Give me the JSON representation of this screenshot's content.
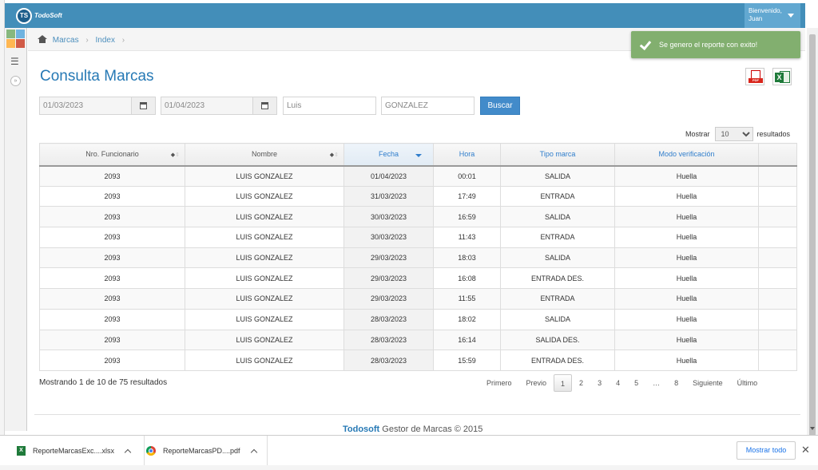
{
  "navbar": {
    "logo_initials": "TS",
    "logo_text": "TodoSoft",
    "welcome": "Bienvenido,",
    "user": "Juan"
  },
  "breadcrumb": [
    "Marcas",
    "Index"
  ],
  "toast": "Se genero el reporte con exito!",
  "page_title": "Consulta Marcas",
  "filters": {
    "date_from": "01/03/2023",
    "date_to": "01/04/2023",
    "first_name": "Luis",
    "last_name": "GONZALEZ",
    "search_button": "Buscar"
  },
  "export": {
    "pdf_label": "PDF",
    "xls_label": "X"
  },
  "page_size": {
    "before": "Mostrar",
    "value": "10",
    "after": "resultados"
  },
  "table": {
    "columns": [
      "Nro. Funcionario",
      "Nombre",
      "Fecha",
      "Hora",
      "Tipo marca",
      "Modo verificación",
      ""
    ],
    "rows": [
      [
        "2093",
        "LUIS GONZALEZ",
        "01/04/2023",
        "00:01",
        "SALIDA",
        "Huella",
        ""
      ],
      [
        "2093",
        "LUIS GONZALEZ",
        "31/03/2023",
        "17:49",
        "ENTRADA",
        "Huella",
        ""
      ],
      [
        "2093",
        "LUIS GONZALEZ",
        "30/03/2023",
        "16:59",
        "SALIDA",
        "Huella",
        ""
      ],
      [
        "2093",
        "LUIS GONZALEZ",
        "30/03/2023",
        "11:43",
        "ENTRADA",
        "Huella",
        ""
      ],
      [
        "2093",
        "LUIS GONZALEZ",
        "29/03/2023",
        "18:03",
        "SALIDA",
        "Huella",
        ""
      ],
      [
        "2093",
        "LUIS GONZALEZ",
        "29/03/2023",
        "16:08",
        "ENTRADA DES.",
        "Huella",
        ""
      ],
      [
        "2093",
        "LUIS GONZALEZ",
        "29/03/2023",
        "11:55",
        "ENTRADA",
        "Huella",
        ""
      ],
      [
        "2093",
        "LUIS GONZALEZ",
        "28/03/2023",
        "18:02",
        "SALIDA",
        "Huella",
        ""
      ],
      [
        "2093",
        "LUIS GONZALEZ",
        "28/03/2023",
        "16:14",
        "SALIDA DES.",
        "Huella",
        ""
      ],
      [
        "2093",
        "LUIS GONZALEZ",
        "28/03/2023",
        "15:59",
        "ENTRADA DES.",
        "Huella",
        ""
      ]
    ]
  },
  "info": "Mostrando 1 de 10 de 75 resultados",
  "pagination": {
    "first": "Primero",
    "prev": "Previo",
    "pages": [
      "1",
      "2",
      "3",
      "4",
      "5",
      "…",
      "8"
    ],
    "active": "1",
    "next": "Siguiente",
    "last": "Último"
  },
  "footer": {
    "brand": "Todosoft",
    "text": "Gestor de Marcas © 2015"
  },
  "downloads": {
    "items": [
      {
        "name": "ReporteMarcasExc....xlsx",
        "icon": "xlsx-file-icon"
      },
      {
        "name": "ReporteMarcasPD....pdf",
        "icon": "chrome-icon"
      }
    ],
    "show_all": "Mostrar todo",
    "close": "✕"
  },
  "colors": {
    "navbar": "#438eb9",
    "accent": "#2679b5",
    "toast": "#82af6f",
    "button": "#428bca"
  }
}
